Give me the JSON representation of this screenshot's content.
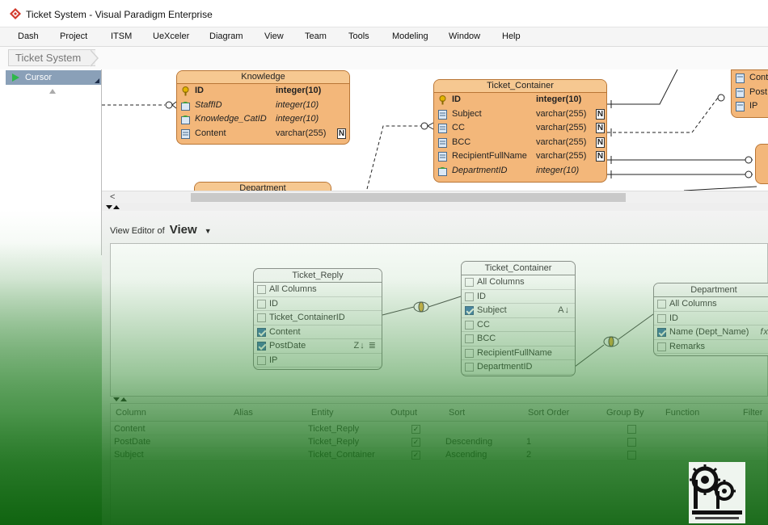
{
  "window": {
    "title": "Ticket System - Visual Paradigm Enterprise"
  },
  "menu": [
    "Dash",
    "Project",
    "ITSM",
    "UeXceler",
    "Diagram",
    "View",
    "Team",
    "Tools",
    "Modeling",
    "Window",
    "Help"
  ],
  "breadcrumb": "Ticket System",
  "palette": {
    "selected_tool": "Cursor"
  },
  "erd": {
    "knowledge": {
      "name": "Knowledge",
      "rows": [
        {
          "name": "ID",
          "type": "integer(10)",
          "kind": "pk"
        },
        {
          "name": "StaffID",
          "type": "integer(10)",
          "kind": "fk"
        },
        {
          "name": "Knowledge_CatID",
          "type": "integer(10)",
          "kind": "fk"
        },
        {
          "name": "Content",
          "type": "varchar(255)",
          "kind": "col",
          "nullable": "N"
        }
      ]
    },
    "ticket_container": {
      "name": "Ticket_Container",
      "rows": [
        {
          "name": "ID",
          "type": "integer(10)",
          "kind": "pk"
        },
        {
          "name": "Subject",
          "type": "varchar(255)",
          "kind": "col",
          "nullable": "N"
        },
        {
          "name": "CC",
          "type": "varchar(255)",
          "kind": "col",
          "nullable": "N"
        },
        {
          "name": "BCC",
          "type": "varchar(255)",
          "kind": "col",
          "nullable": "N"
        },
        {
          "name": "RecipientFullName",
          "type": "varchar(255)",
          "kind": "col",
          "nullable": "N"
        },
        {
          "name": "DepartmentID",
          "type": "integer(10)",
          "kind": "fk"
        }
      ]
    },
    "department": {
      "name": "Department"
    },
    "partial_right": {
      "rows": [
        "Cont",
        "Post",
        "IP"
      ]
    }
  },
  "view_editor": {
    "label": "View Editor of",
    "view_name": "View",
    "tables": [
      {
        "name": "Ticket_Reply",
        "rows": [
          {
            "label": "All Columns",
            "checked": false
          },
          {
            "label": "ID",
            "checked": false
          },
          {
            "label": "Ticket_ContainerID",
            "checked": false
          },
          {
            "label": "Content",
            "checked": true
          },
          {
            "label": "PostDate",
            "checked": true,
            "tools": "Z↓ ≣"
          },
          {
            "label": "IP",
            "checked": false
          }
        ]
      },
      {
        "name": "Ticket_Container",
        "rows": [
          {
            "label": "All Columns",
            "checked": false
          },
          {
            "label": "ID",
            "checked": false
          },
          {
            "label": "Subject",
            "checked": true,
            "tools": "A↓"
          },
          {
            "label": "CC",
            "checked": false
          },
          {
            "label": "BCC",
            "checked": false
          },
          {
            "label": "RecipientFullName",
            "checked": false
          },
          {
            "label": "DepartmentID",
            "checked": false
          }
        ]
      },
      {
        "name": "Department",
        "rows": [
          {
            "label": "All Columns",
            "checked": false
          },
          {
            "label": "ID",
            "checked": false
          },
          {
            "label": "Name (Dept_Name)",
            "checked": true,
            "tools": "fx"
          },
          {
            "label": "Remarks",
            "checked": false
          }
        ]
      }
    ],
    "grid": {
      "headers": [
        "Column",
        "Alias",
        "Entity",
        "Output",
        "Sort",
        "Sort Order",
        "Group By",
        "Function",
        "Filter"
      ],
      "rows": [
        {
          "column": "Content",
          "alias": "",
          "entity": "Ticket_Reply",
          "output": true,
          "sort": "",
          "sort_order": "",
          "group_by": false
        },
        {
          "column": "PostDate",
          "alias": "",
          "entity": "Ticket_Reply",
          "output": true,
          "sort": "Descending",
          "sort_order": "1",
          "group_by": false
        },
        {
          "column": "Subject",
          "alias": "",
          "entity": "Ticket_Container",
          "output": true,
          "sort": "Ascending",
          "sort_order": "2",
          "group_by": false
        }
      ]
    }
  },
  "colors": {
    "entity_fill": "#f3b77a",
    "accent": "#2e6eb0",
    "watermark_green": "#107010"
  }
}
